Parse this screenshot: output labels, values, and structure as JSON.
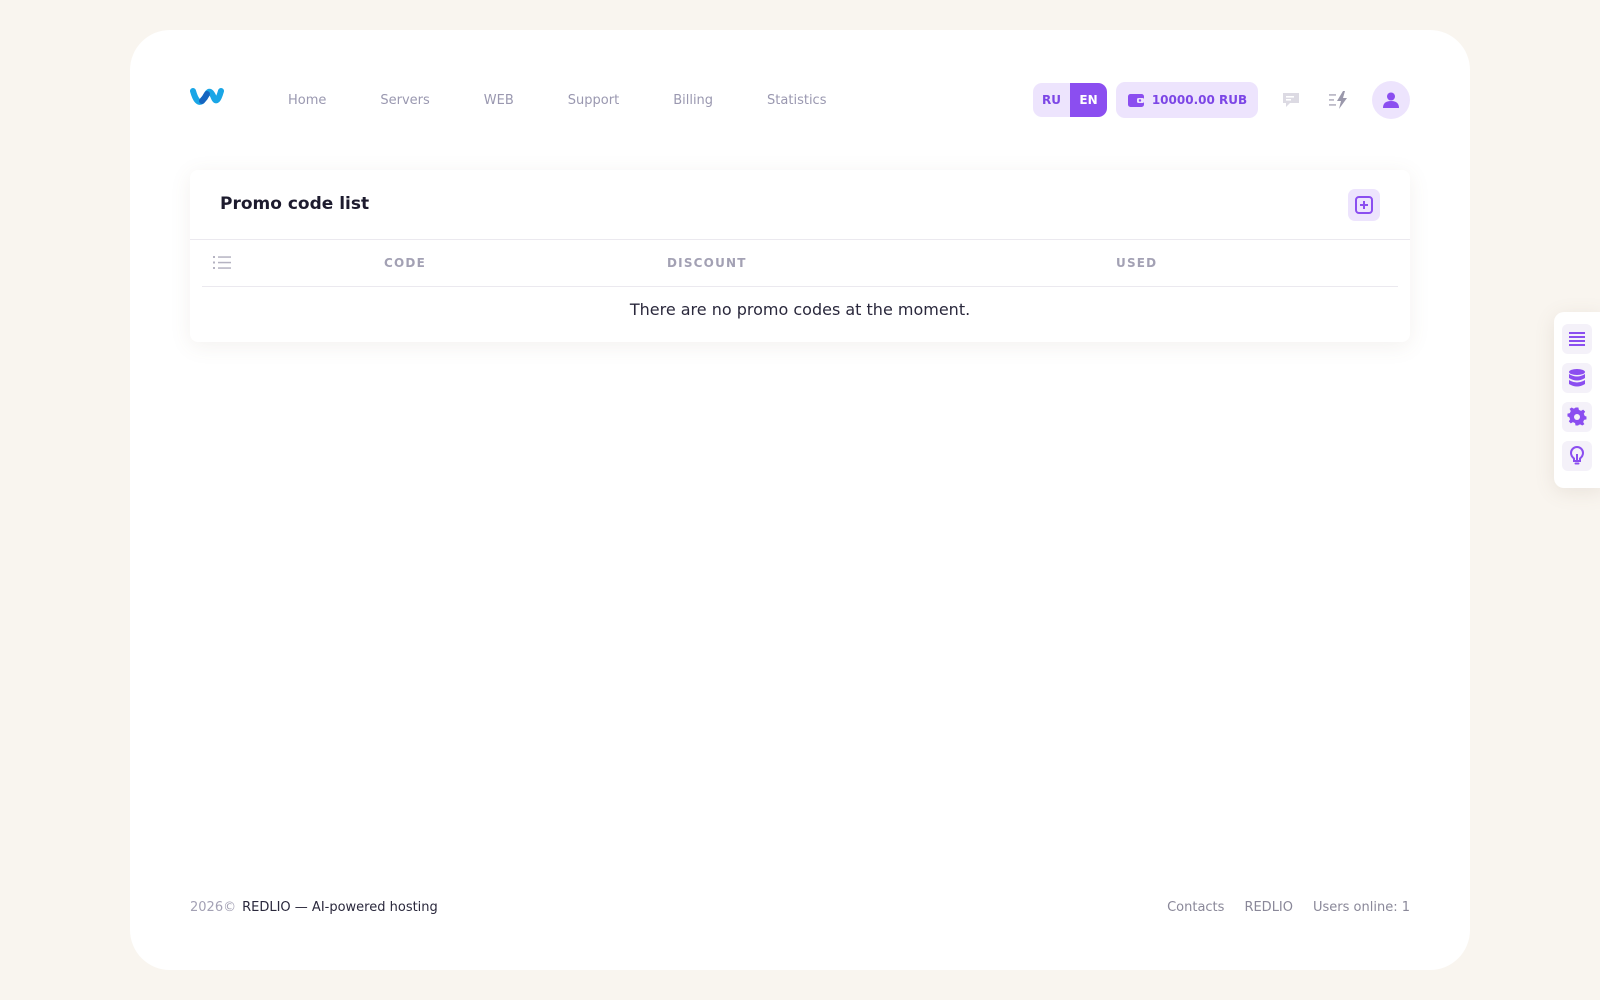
{
  "header": {
    "nav": [
      "Home",
      "Servers",
      "WEB",
      "Support",
      "Billing",
      "Statistics"
    ],
    "lang": {
      "ru": "RU",
      "en": "EN",
      "active": "EN"
    },
    "balance": "10000.00 RUB"
  },
  "card": {
    "title": "Promo code list",
    "columns": [
      "CODE",
      "DISCOUNT",
      "USED"
    ],
    "empty_message": "There are no promo codes at the moment."
  },
  "footer": {
    "year": "2026©",
    "brand_text": "REDLIO — AI-powered hosting",
    "links": [
      "Contacts",
      "REDLIO"
    ],
    "users_online": "Users online: 1"
  },
  "colors": {
    "accent": "#8b4ef0",
    "accent_light": "#ede4fd",
    "page_bg": "#f9f5ef",
    "logo_blue": "#1aa6e6"
  },
  "icons": {
    "logo": "wave-logo-icon",
    "balance": "wallet-icon",
    "messages": "chat-icon",
    "activity": "lightning-icon",
    "avatar": "user-icon",
    "add": "plus-square-icon",
    "list": "numbered-list-icon",
    "side": [
      "list-lines-icon",
      "database-icon",
      "gear-icon",
      "lightbulb-icon"
    ]
  }
}
